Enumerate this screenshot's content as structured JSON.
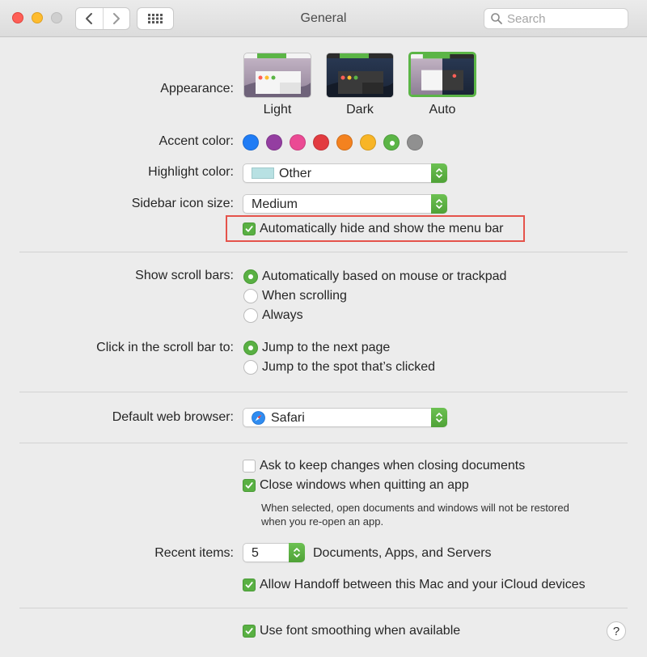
{
  "window": {
    "title": "General"
  },
  "search": {
    "placeholder": "Search"
  },
  "appearance": {
    "label": "Appearance:",
    "options": [
      {
        "name": "Light"
      },
      {
        "name": "Dark"
      },
      {
        "name": "Auto",
        "selected": true
      }
    ]
  },
  "accent": {
    "label": "Accent color:",
    "colors": [
      "#1f7cf5",
      "#943ea1",
      "#eb4a94",
      "#e23b40",
      "#f4821f",
      "#f8b526",
      "#5bb546",
      "#909090"
    ],
    "selected_index": 6
  },
  "highlight": {
    "label": "Highlight color:",
    "value": "Other",
    "swatch": "#b8e1e3"
  },
  "sidebar_icon": {
    "label": "Sidebar icon size:",
    "value": "Medium"
  },
  "menu_bar": {
    "label": "Automatically hide and show the menu bar",
    "checked": true
  },
  "scroll_bars": {
    "label": "Show scroll bars:",
    "options": [
      "Automatically based on mouse or trackpad",
      "When scrolling",
      "Always"
    ],
    "selected_index": 0
  },
  "click_scroll": {
    "label": "Click in the scroll bar to:",
    "options": [
      "Jump to the next page",
      "Jump to the spot that’s clicked"
    ],
    "selected_index": 0
  },
  "browser": {
    "label": "Default web browser:",
    "value": "Safari"
  },
  "documents": {
    "ask_keep": {
      "label": "Ask to keep changes when closing documents",
      "checked": false
    },
    "close_windows": {
      "label": "Close windows when quitting an app",
      "checked": true
    },
    "note_line1": "When selected, open documents and windows will not be restored",
    "note_line2": "when you re-open an app."
  },
  "recent": {
    "label": "Recent items:",
    "value": "5",
    "suffix": "Documents, Apps, and Servers"
  },
  "handoff": {
    "label": "Allow Handoff between this Mac and your iCloud devices",
    "checked": true
  },
  "font_smoothing": {
    "label": "Use font smoothing when available",
    "checked": true
  },
  "help": {
    "label": "?"
  },
  "colors": {
    "accent_green": "#59b043",
    "annotation_red": "#e5534b"
  }
}
